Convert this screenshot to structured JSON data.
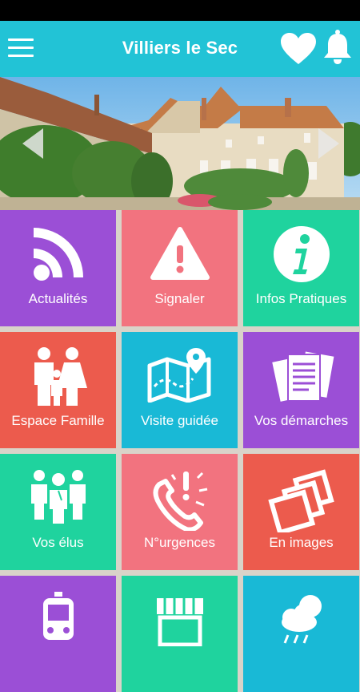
{
  "app": {
    "title": "Villiers le Sec"
  },
  "header": {
    "menu_icon": "hamburger-menu-icon",
    "favorites_icon": "heart-icon",
    "notifications_icon": "bell-icon"
  },
  "carousel": {
    "prev_icon": "chevron-left-icon",
    "next_icon": "chevron-right-icon"
  },
  "tiles": [
    {
      "label": "Actualités",
      "icon": "rss-feed-icon",
      "color": "#9b4fd6"
    },
    {
      "label": "Signaler",
      "icon": "warning-triangle-icon",
      "color": "#f2737f"
    },
    {
      "label": "Infos Pratiques",
      "icon": "info-icon",
      "color": "#1fd39e"
    },
    {
      "label": "Espace Famille",
      "icon": "family-icon",
      "color": "#ec5b4d"
    },
    {
      "label": "Visite guidée",
      "icon": "map-pin-icon",
      "color": "#19b9d6"
    },
    {
      "label": "Vos démarches",
      "icon": "documents-icon",
      "color": "#9b4fd6"
    },
    {
      "label": "Vos élus",
      "icon": "group-people-icon",
      "color": "#1fd39e"
    },
    {
      "label": "N°urgences",
      "icon": "phone-alert-icon",
      "color": "#f2737f"
    },
    {
      "label": "En images",
      "icon": "photos-icon",
      "color": "#ec5b4d"
    },
    {
      "label": "",
      "icon": "train-icon",
      "color": "#9b4fd6"
    },
    {
      "label": "",
      "icon": "shop-icon",
      "color": "#1fd39e"
    },
    {
      "label": "",
      "icon": "weather-icon",
      "color": "#19b9d6"
    }
  ],
  "colors": {
    "appbar": "#22c3d6",
    "purple": "#9b4fd6",
    "pink": "#f2737f",
    "green": "#1fd39e",
    "red": "#ec5b4d",
    "cyan": "#19b9d6"
  }
}
